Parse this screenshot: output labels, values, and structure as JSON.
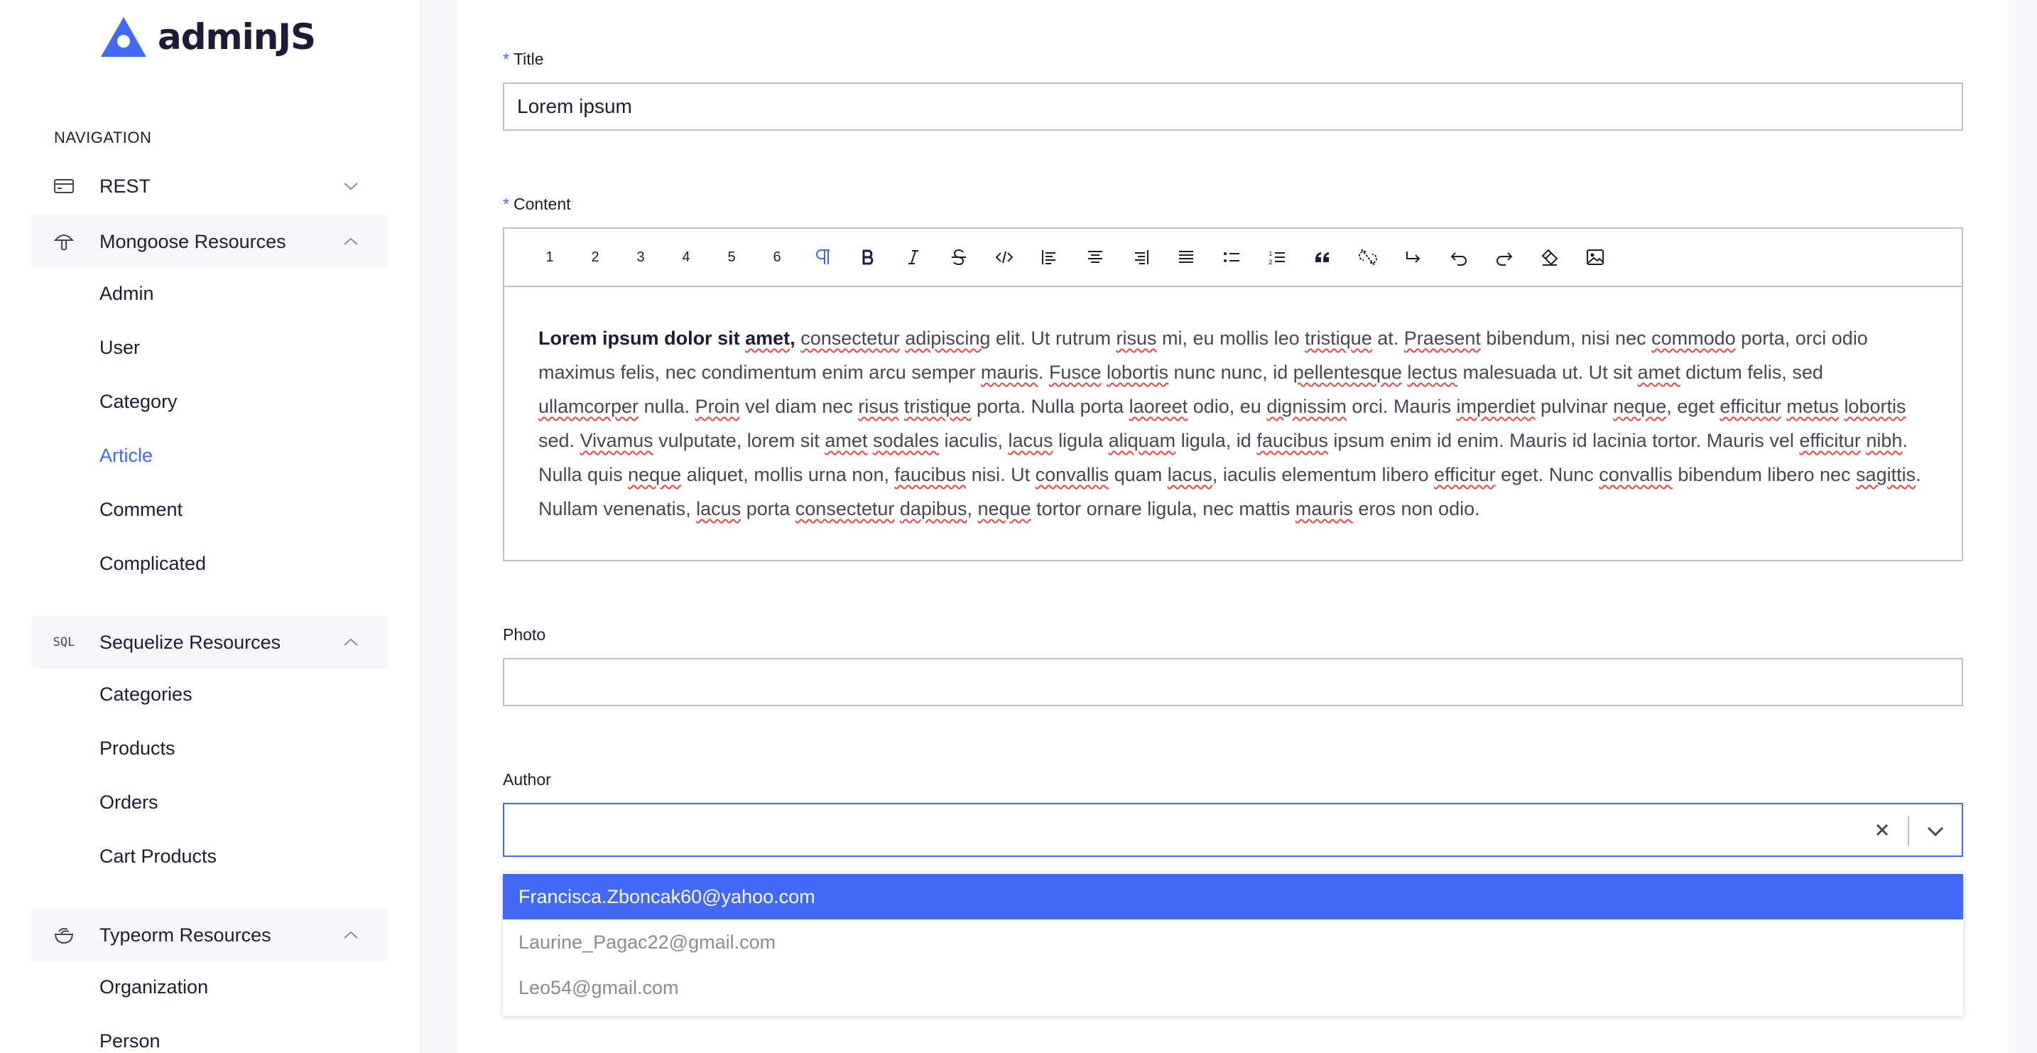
{
  "app": {
    "logo_text": "adminJS",
    "accent": "#4268f6"
  },
  "sidebar": {
    "nav_title": "NAVIGATION",
    "groups": [
      {
        "label": "REST",
        "icon": "credit-card-icon",
        "expanded": false,
        "items": []
      },
      {
        "label": "Mongoose Resources",
        "icon": "mushroom-icon",
        "expanded": true,
        "items": [
          "Admin",
          "User",
          "Category",
          "Article",
          "Comment",
          "Complicated"
        ]
      },
      {
        "label": "Sequelize Resources",
        "icon": "sql-icon",
        "icon_text": "SQL",
        "expanded": true,
        "items": [
          "Categories",
          "Products",
          "Orders",
          "Cart Products"
        ]
      },
      {
        "label": "Typeorm Resources",
        "icon": "bowl-icon",
        "expanded": true,
        "items": [
          "Organization",
          "Person"
        ]
      }
    ],
    "selected_item": "Article"
  },
  "form": {
    "title_label": "Title",
    "title_value": "Lorem ipsum",
    "required_mark": "*",
    "content_label": "Content",
    "toolbar": {
      "h1": "1",
      "h2": "2",
      "h3": "3",
      "h4": "4",
      "h5": "5",
      "h6": "6"
    },
    "content": {
      "bold_lead": "Lorem ipsum dolor sit amet,",
      "text": " consectetur adipiscing elit. Ut rutrum risus mi, eu mollis leo tristique at. Praesent bibendum, nisi nec commodo porta, orci odio maximus felis, nec condimentum enim arcu semper mauris. Fusce lobortis nunc nunc, id pellentesque lectus malesuada ut. Ut sit amet dictum felis, sed ullamcorper nulla. Proin vel diam nec risus tristique porta. Nulla porta laoreet odio, eu dignissim orci. Mauris imperdiet pulvinar neque, eget efficitur metus lobortis sed. Vivamus vulputate, lorem sit amet sodales iaculis, lacus ligula aliquam ligula, id faucibus ipsum enim id enim. Mauris id lacinia tortor. Mauris vel efficitur nibh. Nulla quis neque aliquet, mollis urna non, faucibus nisi. Ut convallis quam lacus, iaculis elementum libero efficitur eget. Nunc convallis bibendum libero nec sagittis. Nullam venenatis, lacus porta consectetur dapibus, neque tortor ornare ligula, nec mattis mauris eros non odio."
    },
    "photo_label": "Photo",
    "author_label": "Author",
    "author_value": "",
    "author_options": [
      "Francisca.Zboncak60@yahoo.com",
      "Laurine_Pagac22@gmail.com",
      "Leo54@gmail.com"
    ],
    "highlighted_option": "Francisca.Zboncak60@yahoo.com"
  }
}
